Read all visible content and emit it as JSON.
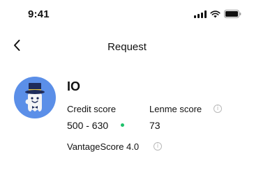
{
  "status_bar": {
    "time": "9:41",
    "icons": [
      "signal-icon",
      "wifi-icon",
      "battery-icon"
    ]
  },
  "header": {
    "title": "Request",
    "back_icon": "chevron-left-icon"
  },
  "profile": {
    "name": "IO",
    "avatar_icon": "top-hat-tooth-mascot-icon",
    "credit_score_label": "Credit score",
    "credit_score_value": "500 - 630",
    "credit_score_status_color": "#1fc16b",
    "lenme_score_label": "Lenme score",
    "lenme_score_value": "73",
    "vantage_label": "VantageScore 4.0"
  },
  "colors": {
    "avatar_bg": "#5b8fe8",
    "info_icon": "#b9b9b9",
    "text": "#111111"
  }
}
